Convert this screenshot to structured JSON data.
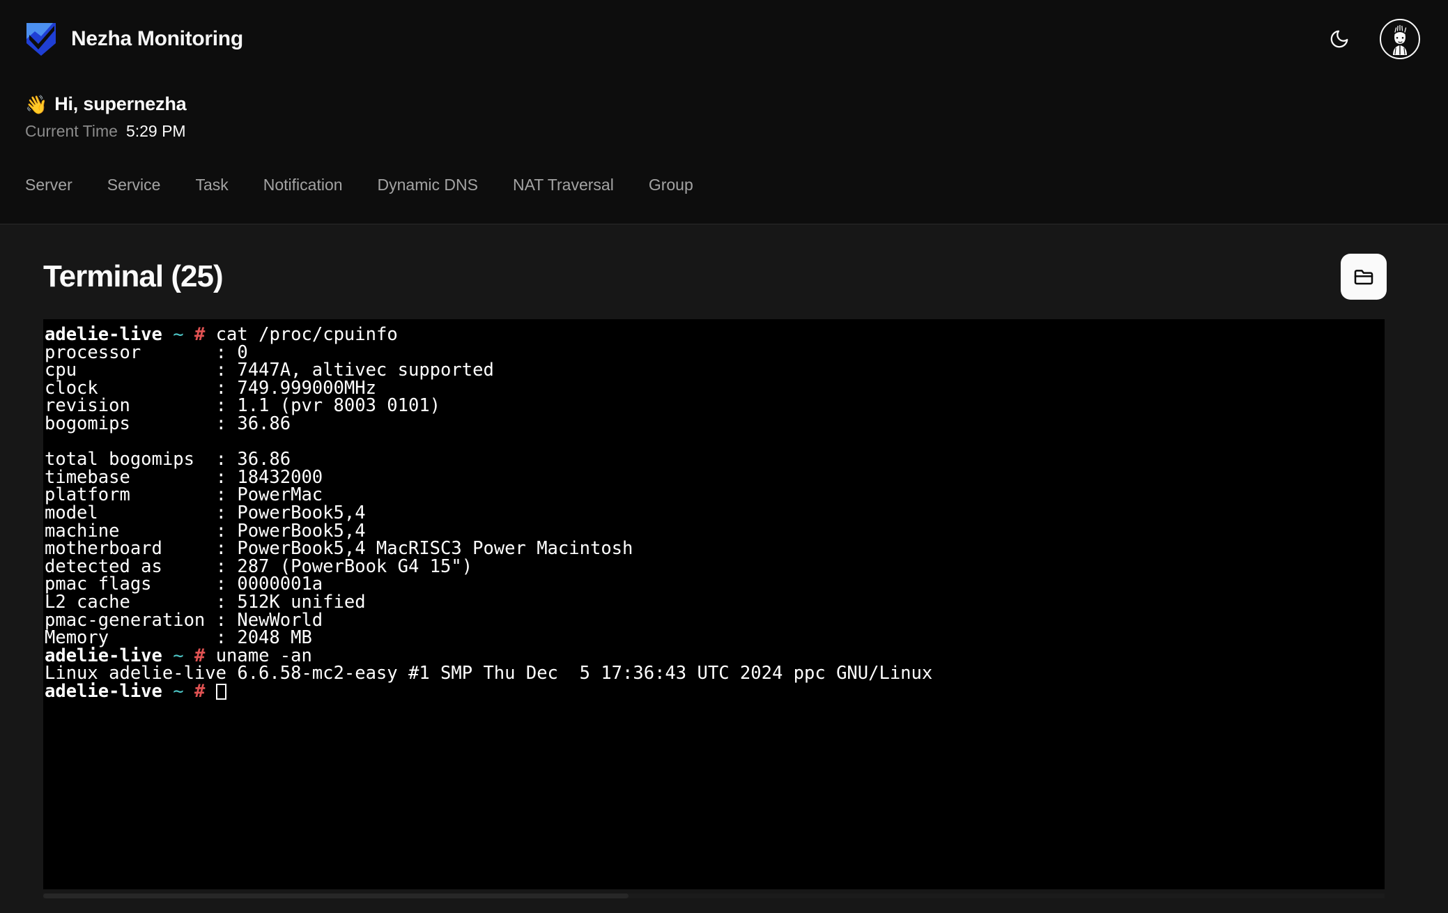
{
  "header": {
    "brand_title": "Nezha Monitoring",
    "logo_icon": "shield-check-icon",
    "theme_toggle_icon": "moon-icon",
    "avatar_icon": "user-avatar",
    "accent_blue_light": "#4c90f0",
    "accent_blue_dark": "#1f3fd4"
  },
  "greeting": {
    "wave_emoji": "👋",
    "text": "Hi, supernezha",
    "time_label": "Current Time",
    "time_value": "5:29 PM"
  },
  "nav": {
    "tabs": [
      {
        "label": "Server"
      },
      {
        "label": "Service"
      },
      {
        "label": "Task"
      },
      {
        "label": "Notification"
      },
      {
        "label": "Dynamic DNS"
      },
      {
        "label": "NAT Traversal"
      },
      {
        "label": "Group"
      }
    ]
  },
  "panel": {
    "title": "Terminal (25)",
    "file_manager_icon": "folder-icon"
  },
  "terminal": {
    "prompt_host": "adelie-live",
    "prompt_tilde": "~",
    "prompt_hash": "#",
    "colors": {
      "background": "#000000",
      "foreground": "#ffffff",
      "tilde": "#4ec9c9",
      "hash": "#e05252"
    },
    "lines": [
      {
        "type": "prompt",
        "command": "cat /proc/cpuinfo"
      },
      {
        "type": "out",
        "text": "processor       : 0"
      },
      {
        "type": "out",
        "text": "cpu             : 7447A, altivec supported"
      },
      {
        "type": "out",
        "text": "clock           : 749.999000MHz"
      },
      {
        "type": "out",
        "text": "revision        : 1.1 (pvr 8003 0101)"
      },
      {
        "type": "out",
        "text": "bogomips        : 36.86"
      },
      {
        "type": "out",
        "text": ""
      },
      {
        "type": "out",
        "text": "total bogomips  : 36.86"
      },
      {
        "type": "out",
        "text": "timebase        : 18432000"
      },
      {
        "type": "out",
        "text": "platform        : PowerMac"
      },
      {
        "type": "out",
        "text": "model           : PowerBook5,4"
      },
      {
        "type": "out",
        "text": "machine         : PowerBook5,4"
      },
      {
        "type": "out",
        "text": "motherboard     : PowerBook5,4 MacRISC3 Power Macintosh"
      },
      {
        "type": "out",
        "text": "detected as     : 287 (PowerBook G4 15\")"
      },
      {
        "type": "out",
        "text": "pmac flags      : 0000001a"
      },
      {
        "type": "out",
        "text": "L2 cache        : 512K unified"
      },
      {
        "type": "out",
        "text": "pmac-generation : NewWorld"
      },
      {
        "type": "out",
        "text": "Memory          : 2048 MB"
      },
      {
        "type": "prompt",
        "command": "uname -an"
      },
      {
        "type": "out",
        "text": "Linux adelie-live 6.6.58-mc2-easy #1 SMP Thu Dec  5 17:36:43 UTC 2024 ppc GNU/Linux"
      },
      {
        "type": "prompt-cursor",
        "command": ""
      }
    ]
  }
}
